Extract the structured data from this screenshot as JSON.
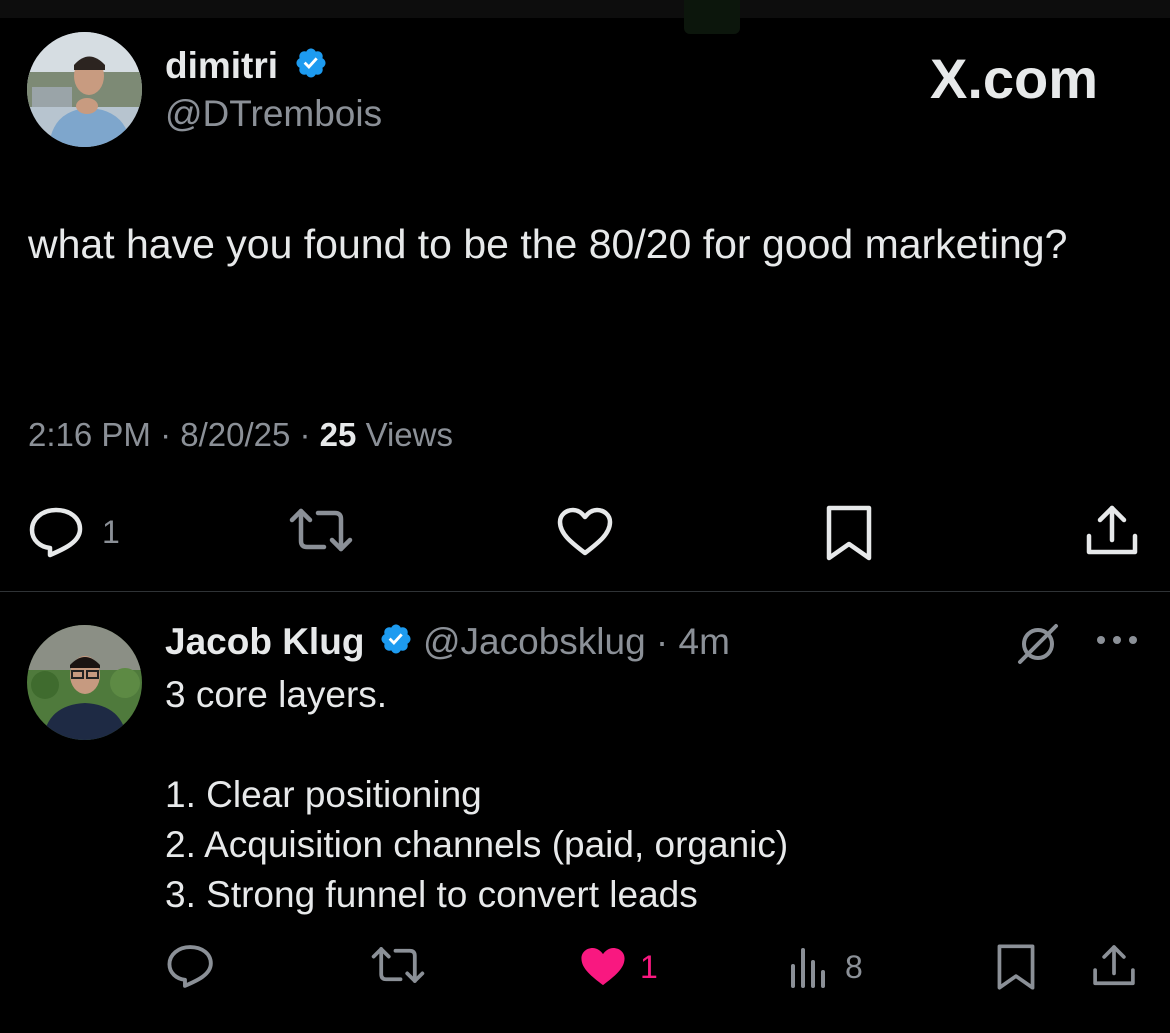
{
  "header": {
    "display_name": "dimitri",
    "handle": "@DTrembois",
    "brand_label": "X.com"
  },
  "tweet": {
    "text": "what have you found to be the 80/20 for good marketing?",
    "time": "2:16 PM",
    "date": "8/20/25",
    "views_count": "25",
    "views_label": "Views",
    "separator": " · ",
    "reply_count": "1"
  },
  "reply": {
    "display_name": "Jacob Klug",
    "handle": "@Jacobsklug",
    "separator": " · ",
    "age": "4m",
    "text": "3 core layers.\n\n1. Clear positioning\n2. Acquisition channels (paid, organic)\n3. Strong funnel to convert leads",
    "like_count": "1",
    "views_count": "8"
  },
  "colors": {
    "background": "#000000",
    "primary_text": "#e7e9ea",
    "secondary_text": "#8b9097",
    "verified_badge": "#1d9bf0",
    "like_active": "#f91880",
    "divider": "#2f3336"
  },
  "icons": {
    "reply": "reply-bubble-icon",
    "repost": "repost-icon",
    "like": "heart-icon",
    "bookmark": "bookmark-icon",
    "share": "share-icon",
    "views": "views-chart-icon",
    "verified": "verified-badge-icon",
    "grok": "grok-icon",
    "more": "more-dots-icon"
  }
}
